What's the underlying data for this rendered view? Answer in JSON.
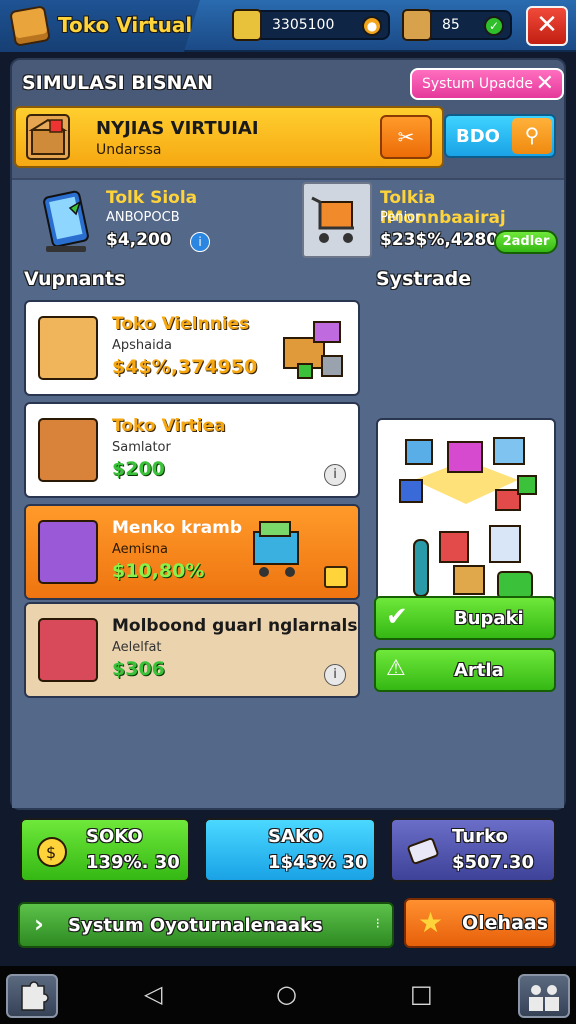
{
  "header": {
    "app_title": "Toko Virtual",
    "resource1": "3305100",
    "resource2": "85",
    "close_label": "✕"
  },
  "panel": {
    "title": "SIMULASI BISNAN",
    "update_button": "Systum Upadde",
    "banner": {
      "title": "NYJIAS VIRTUIAI",
      "subtitle": "Undarssa",
      "action_glyph": "✂",
      "field_label": "BDO"
    }
  },
  "info_left": {
    "title": "Tolk Siola",
    "subtitle": "ANBOPOCB",
    "price": "$4,200"
  },
  "info_right": {
    "title": "Tolkia IMonnbaairaj",
    "subtitle": "Penior",
    "price": "$23$%,4280",
    "badge": "2adler"
  },
  "sections": {
    "left": "Vupnants",
    "right": "Systrade"
  },
  "products": [
    {
      "title": "Toko Vielnnies",
      "subtitle": "Apshaida",
      "price": "$4$%,374950"
    },
    {
      "title": "Toko Virtiea",
      "subtitle": "Samlator",
      "price": "$200"
    },
    {
      "title": "Menko kramb",
      "subtitle": "Aemisna",
      "price": "$10,80%"
    },
    {
      "title": "Molboond guarl nglarnals",
      "subtitle": "Aelelfat",
      "price": "$306"
    }
  ],
  "action_buttons": {
    "confirm": "Bupaki",
    "confirm_icon": "✔",
    "secondary": "Artla",
    "secondary_icon": "⚠"
  },
  "bottom_buttons": [
    {
      "line1": "SOKO",
      "line2": "139%. 30"
    },
    {
      "line1": "SAKO",
      "line2": "1$43% 30"
    },
    {
      "line1": "Turko",
      "line2": "$507.30"
    }
  ],
  "footer": {
    "long_button": "Systum Oyoturnalenaaks",
    "orange_button": "Olehaas"
  },
  "nav": {
    "back": "◁",
    "home": "○",
    "recent": "□"
  },
  "colors": {
    "accent_yellow": "#ffd43a",
    "accent_green": "#35b814",
    "accent_orange": "#ec6c08",
    "accent_cyan": "#1aa2e6",
    "danger": "#c21f12"
  }
}
